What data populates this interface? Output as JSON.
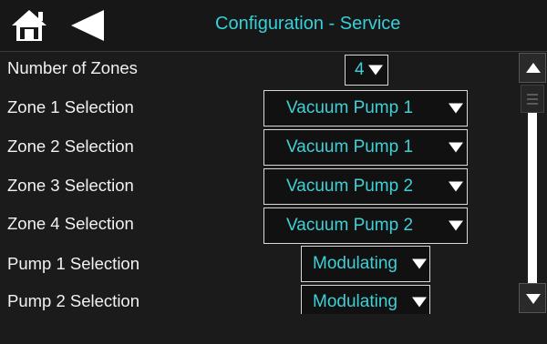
{
  "header": {
    "title": "Configuration - Service",
    "home_icon": "home-icon",
    "back_icon": "back-arrow-icon"
  },
  "rows": [
    {
      "label": "Number of Zones",
      "value": "4"
    },
    {
      "label": "Zone 1 Selection",
      "value": "Vacuum Pump 1"
    },
    {
      "label": "Zone 2 Selection",
      "value": "Vacuum Pump 1"
    },
    {
      "label": "Zone 3 Selection",
      "value": "Vacuum Pump 2"
    },
    {
      "label": "Zone 4 Selection",
      "value": "Vacuum Pump 2"
    },
    {
      "label": "Pump 1 Selection",
      "value": "Modulating"
    },
    {
      "label": "Pump 2 Selection",
      "value": "Modulating"
    }
  ],
  "scrollbar": {
    "up_icon": "scroll-up-icon",
    "down_icon": "scroll-down-icon"
  },
  "colors": {
    "accent": "#35d0d8",
    "background": "#1b1b1b",
    "text": "#f2f2f2"
  }
}
